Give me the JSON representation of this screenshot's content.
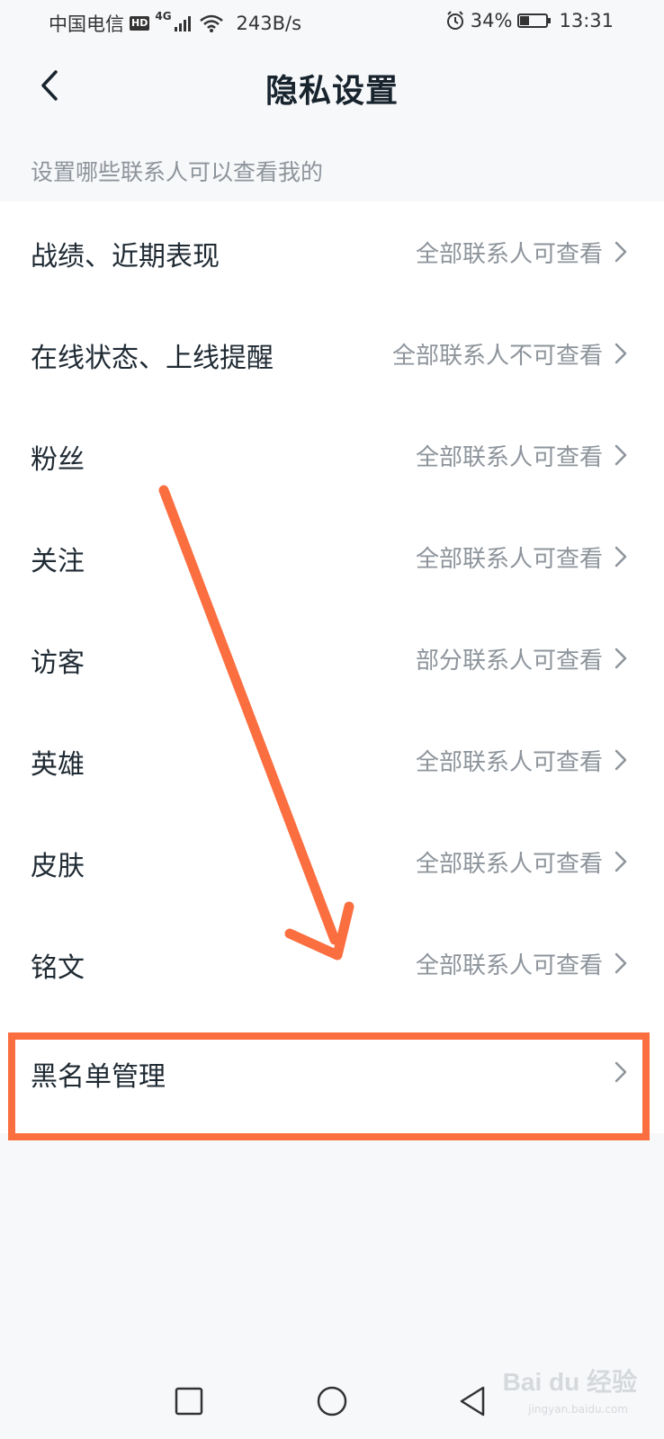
{
  "status_bar": {
    "carrier": "中国电信",
    "hd": "HD",
    "network": "4G",
    "speed": "243B/s",
    "battery_pct": "34%",
    "battery_level": 0.34,
    "time": "13:31"
  },
  "header": {
    "title": "隐私设置"
  },
  "section": {
    "label": "设置哪些联系人可以查看我的"
  },
  "rows": [
    {
      "label": "战绩、近期表现",
      "value": "全部联系人可查看"
    },
    {
      "label": "在线状态、上线提醒",
      "value": "全部联系人不可查看"
    },
    {
      "label": "粉丝",
      "value": "全部联系人可查看"
    },
    {
      "label": "关注",
      "value": "全部联系人可查看"
    },
    {
      "label": "访客",
      "value": "部分联系人可查看"
    },
    {
      "label": "英雄",
      "value": "全部联系人可查看"
    },
    {
      "label": "皮肤",
      "value": "全部联系人可查看"
    },
    {
      "label": "铭文",
      "value": "全部联系人可查看"
    },
    {
      "label": "黑名单管理",
      "value": ""
    }
  ],
  "watermark": {
    "text": "Bai du 经验",
    "sub": "jingyan.baidu.com"
  },
  "colors": {
    "annotation": "#fb6e40",
    "value_text": "#8d949b",
    "background": "#f7f8fa"
  }
}
